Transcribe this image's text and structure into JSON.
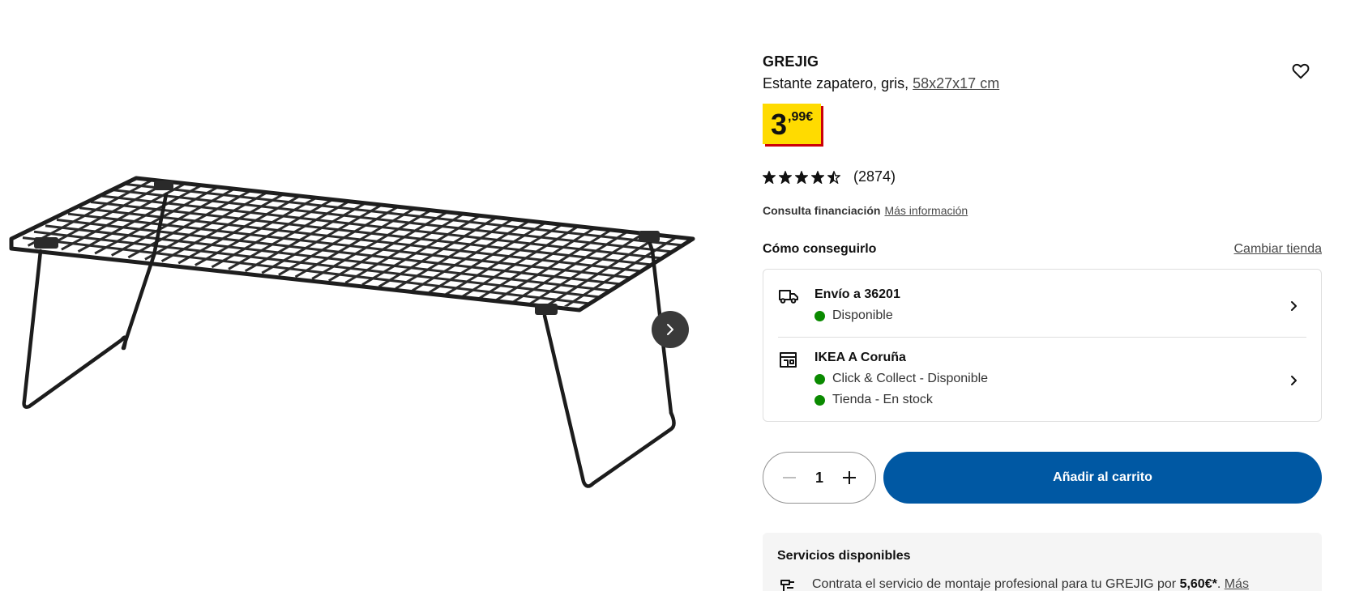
{
  "product": {
    "name": "GREJIG",
    "description": "Estante zapatero, gris,",
    "dimensions": "58x27x17 cm",
    "price_int": "3",
    "price_dec": ",99€",
    "rating_value": 4.5,
    "rating_max": 5,
    "rating_count": "(2874)"
  },
  "finance": {
    "label": "Consulta financiación",
    "link": "Más información"
  },
  "delivery": {
    "heading": "Cómo conseguirlo",
    "change_store": "Cambiar tienda",
    "shipping_title": "Envío a 36201",
    "shipping_status": "Disponible",
    "store_title": "IKEA A Coruña",
    "store_status_1": "Click & Collect - Disponible",
    "store_status_2": "Tienda - En stock"
  },
  "cart": {
    "quantity": "1",
    "add_label": "Añadir al carrito"
  },
  "services": {
    "title": "Servicios disponibles",
    "text_before": "Contrata el servicio de montaje profesional para tu GREJIG por ",
    "text_price": "5,60€*",
    "text_after": ". ",
    "link": "Más"
  },
  "icons": {
    "favorite": "heart-icon",
    "next": "chevron-right-icon",
    "shipping": "truck-icon",
    "store": "store-icon",
    "assembly": "assembly-icon"
  },
  "colors": {
    "accent_blue": "#0058a3",
    "price_yellow": "#ffdb00",
    "price_red": "#cc0008",
    "available_green": "#0a8a00"
  }
}
